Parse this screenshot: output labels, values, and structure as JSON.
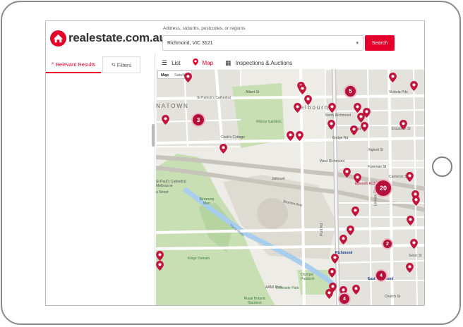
{
  "brand": {
    "name": "realestate.com.au",
    "color": "#e4002b"
  },
  "search": {
    "label": "Address, suburbs, postcodes, or regions",
    "value": "Richmond, VIC 3121",
    "button": "Search"
  },
  "sidebar": {
    "tabs": [
      {
        "label": "Relevant Results",
        "icon": "search-icon"
      },
      {
        "label": "Filters",
        "icon": "sliders-icon"
      }
    ]
  },
  "views": [
    {
      "label": "List",
      "icon": "list-icon"
    },
    {
      "label": "Map",
      "icon": "map-pin-icon",
      "active": true
    },
    {
      "label": "Inspections & Auctions",
      "icon": "calendar-icon"
    }
  ],
  "map": {
    "type_options": [
      "Map",
      "Satellite"
    ],
    "labels": {
      "st_patricks": "St Patrick's Cathedral",
      "chinatown": "NATOWN",
      "melbourne": "Melbourne",
      "fitzroy": "Fitzroy Gardens",
      "cooks": "Cook's Cottage",
      "st_pauls": "St Paul's Cathedral Melbourne",
      "flinders": "a Street",
      "birrarung": "Birrarung Marr",
      "north_richmond": "North Richmond",
      "west_richmond": "West Richmond",
      "epworth": "Epworth Richmond",
      "jolimont": "Jolimont",
      "richmond": "Richmond",
      "east_richmond": "East Richmond",
      "kings_domain": "Kings Domain",
      "aami": "AAMI Park",
      "olympic": "Olympic Paddock",
      "riverside": "Riverside Park",
      "royal_botanic": "Royal Botanic Gardens",
      "yarra": "Yarra River",
      "brunton": "Brunton Ave",
      "bridge_rd": "Bridge Rd",
      "swan_st": "Swan St",
      "victoria_pde": "Victoria Pde",
      "albert_st": "Albert St",
      "gipps_st": "Gipps St",
      "elizabeth_st": "Elizabeth St",
      "highett_st": "Highett St",
      "freeman_st": "Freeman St",
      "cameron_st": "Cameron St",
      "lennox_st": "Lennox St",
      "church_st": "Church St",
      "punt_rd": "Punt Rd"
    },
    "clusters": [
      {
        "count": "3"
      },
      {
        "count": "5"
      },
      {
        "count": "20"
      },
      {
        "count": "2"
      },
      {
        "count": "4"
      },
      {
        "count": "4"
      }
    ]
  }
}
